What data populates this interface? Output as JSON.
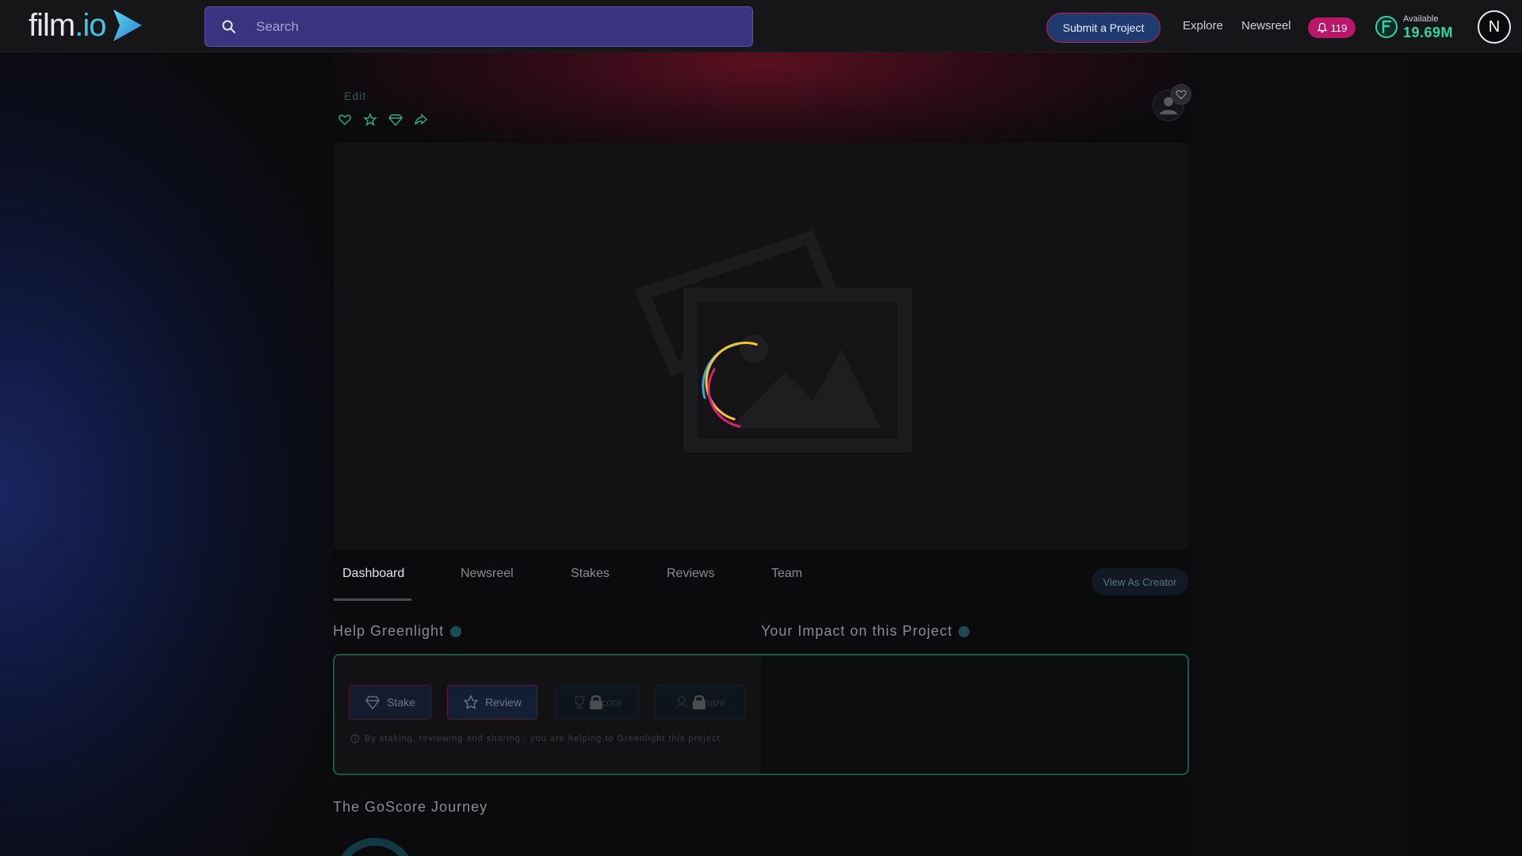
{
  "header": {
    "logo_main": "film",
    "logo_suffix": ".io",
    "search_placeholder": "Search",
    "submit_label": "Submit a Project",
    "explore_label": "Explore",
    "newsreel_label": "Newsreel",
    "notifications_count": "119",
    "wallet_label": "Available",
    "wallet_value": "19.69M",
    "avatar_initial": "N"
  },
  "project": {
    "edit_label": "Edit"
  },
  "tabs": [
    {
      "label": "Dashboard",
      "active": true
    },
    {
      "label": "Newsreel",
      "active": false
    },
    {
      "label": "Stakes",
      "active": false
    },
    {
      "label": "Reviews",
      "active": false
    },
    {
      "label": "Team",
      "active": false
    }
  ],
  "view_as_creator_label": "View As Creator",
  "help_greenlight": {
    "title": "Help Greenlight",
    "buttons": [
      {
        "label": "Stake",
        "icon": "diamond-icon",
        "locked": false
      },
      {
        "label": "Review",
        "icon": "star-icon",
        "locked": false
      },
      {
        "label": "Score",
        "icon": "trophy-icon",
        "locked": true
      },
      {
        "label": "Share",
        "icon": "share-icon",
        "locked": true
      }
    ],
    "note": "By staking, reviewing and sharing , you are helping to Greenlight this project."
  },
  "impact_title": "Your Impact on this Project",
  "goscore_title": "The GoScore Journey",
  "colors": {
    "accent_teal": "#3fc3e6",
    "brand_pink": "#c01d6a",
    "wallet_green": "#2fd6a0",
    "search_bg": "#3a3380"
  }
}
